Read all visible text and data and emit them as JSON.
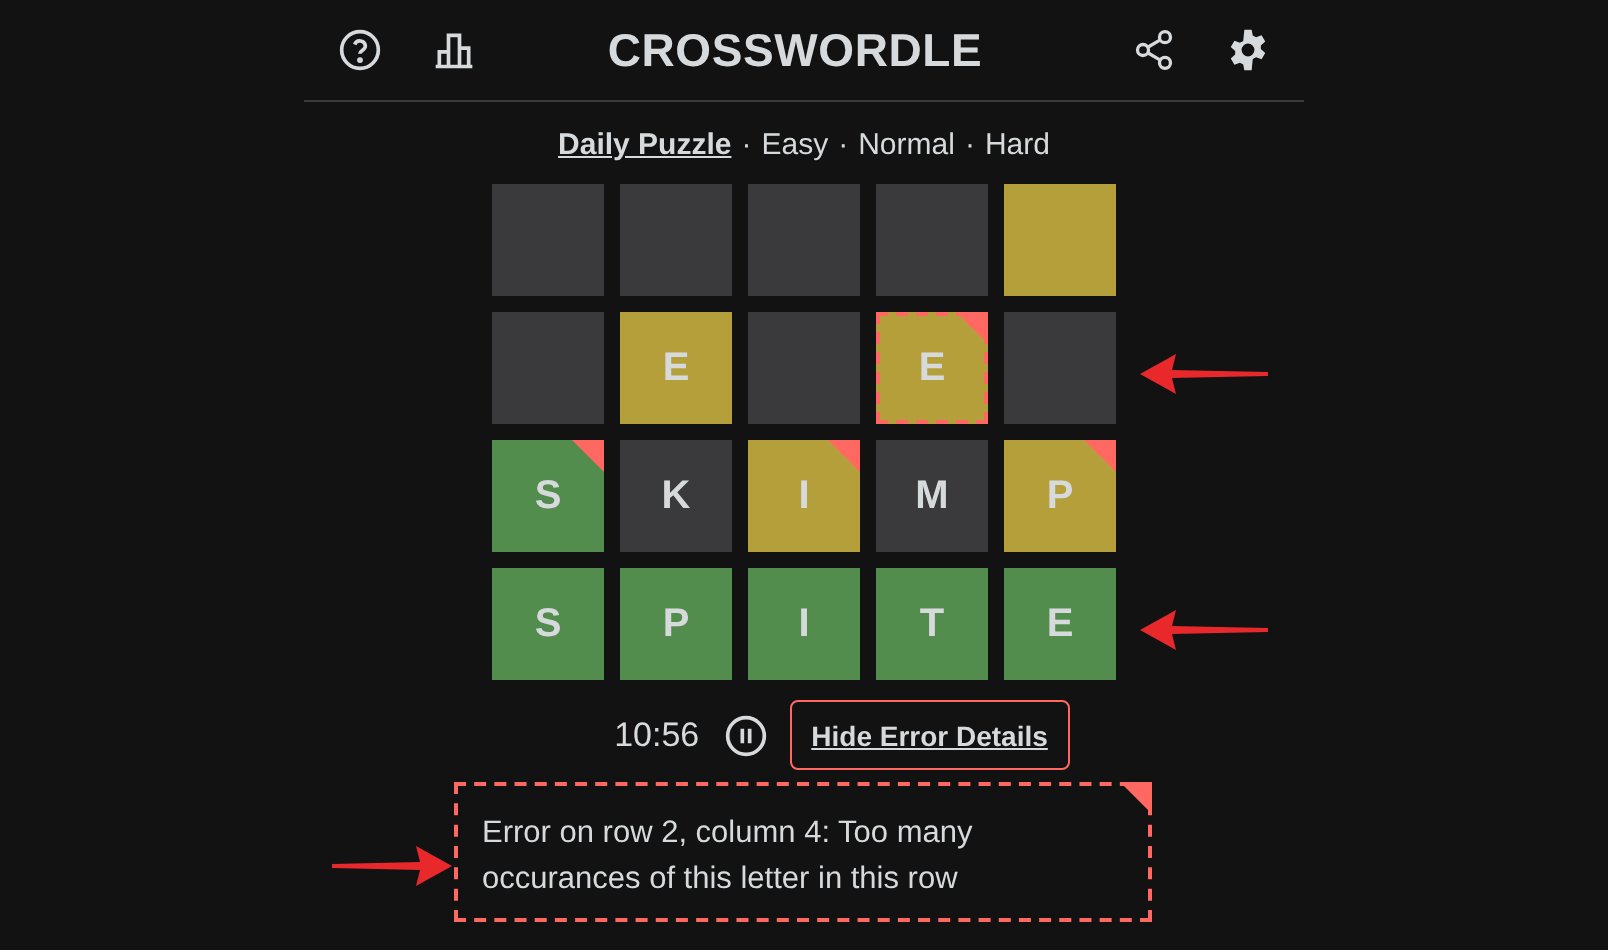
{
  "header": {
    "title": "CROSSWORDLE"
  },
  "modes": [
    {
      "label": "Daily Puzzle",
      "selected": true
    },
    {
      "label": "Easy",
      "selected": false
    },
    {
      "label": "Normal",
      "selected": false
    },
    {
      "label": "Hard",
      "selected": false
    }
  ],
  "mode_separators": [
    "·",
    "·",
    "·"
  ],
  "grid": {
    "rows": [
      {
        "pointer_arrow": false,
        "tiles": [
          {
            "kind": "absent",
            "error": false,
            "selected": false
          },
          {
            "kind": "absent",
            "error": false,
            "selected": false
          },
          {
            "kind": "absent",
            "error": false,
            "selected": false
          },
          {
            "kind": "absent",
            "error": false,
            "selected": false
          },
          {
            "kind": "present",
            "error": false,
            "selected": false
          }
        ]
      },
      {
        "pointer_arrow": true,
        "tiles": [
          {
            "kind": "absent",
            "error": false,
            "selected": false
          },
          {
            "letter": "E",
            "kind": "present",
            "error": false,
            "selected": false
          },
          {
            "kind": "absent",
            "error": false,
            "selected": false
          },
          {
            "letter": "E",
            "kind": "present",
            "error": true,
            "selected": true
          },
          {
            "kind": "absent",
            "error": false,
            "selected": false
          }
        ]
      },
      {
        "pointer_arrow": false,
        "tiles": [
          {
            "letter": "S",
            "kind": "correct",
            "error": true,
            "selected": false
          },
          {
            "letter": "K",
            "kind": "absent",
            "error": false,
            "selected": false
          },
          {
            "letter": "I",
            "kind": "present",
            "error": true,
            "selected": false
          },
          {
            "letter": "M",
            "kind": "absent",
            "error": false,
            "selected": false
          },
          {
            "letter": "P",
            "kind": "present",
            "error": true,
            "selected": false
          }
        ]
      },
      {
        "pointer_arrow": true,
        "tiles": [
          {
            "letter": "S",
            "kind": "correct",
            "error": false,
            "selected": false
          },
          {
            "letter": "P",
            "kind": "correct",
            "error": false,
            "selected": false
          },
          {
            "letter": "I",
            "kind": "correct",
            "error": false,
            "selected": false
          },
          {
            "letter": "T",
            "kind": "correct",
            "error": false,
            "selected": false
          },
          {
            "letter": "E",
            "kind": "correct",
            "error": false,
            "selected": false
          }
        ]
      }
    ]
  },
  "timer": {
    "time": "10:56"
  },
  "error_button": {
    "label": "Hide Error Details"
  },
  "error_details": {
    "text": "Error on row 2, column 4: Too many occurances of this letter in this row",
    "pointer_arrow": true
  }
}
